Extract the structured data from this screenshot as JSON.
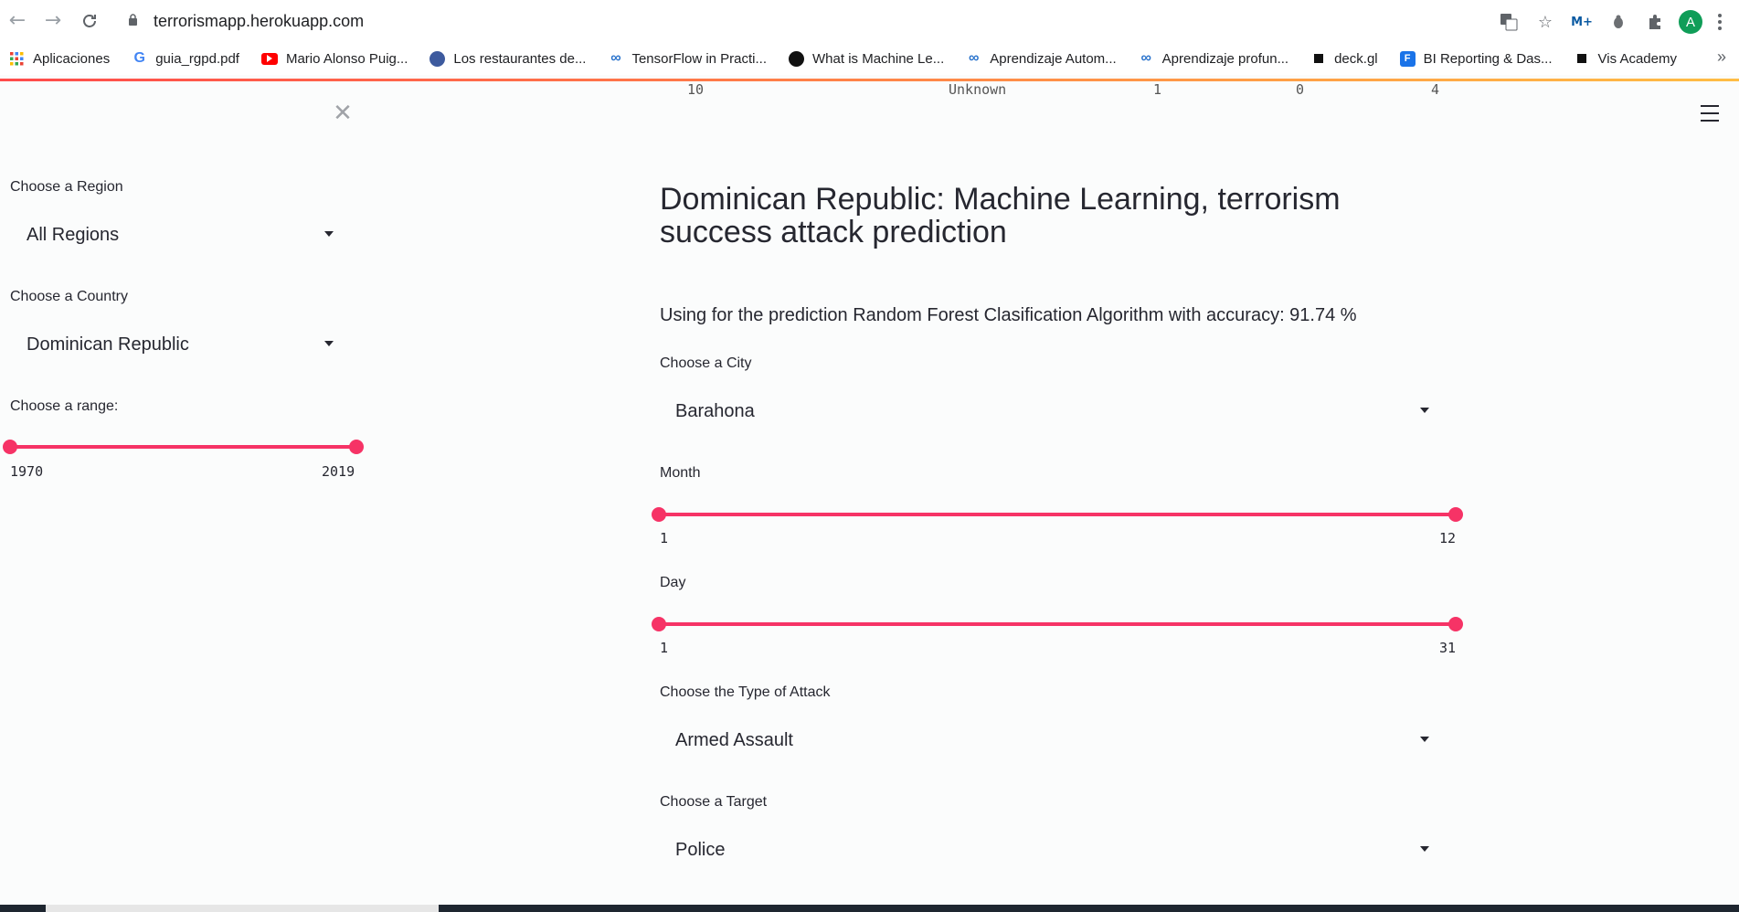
{
  "browser": {
    "url": "terrorismapp.herokuapp.com",
    "profile_initial": "A",
    "bookmarks": [
      {
        "label": "Aplicaciones",
        "icon": "apps-grid-icon"
      },
      {
        "label": "guia_rgpd.pdf",
        "icon": "google-icon"
      },
      {
        "label": "Mario Alonso Puig...",
        "icon": "youtube-icon"
      },
      {
        "label": "Los restaurantes de...",
        "icon": "globe-icon"
      },
      {
        "label": "TensorFlow in Practi...",
        "icon": "coursera-icon"
      },
      {
        "label": "What is Machine Le...",
        "icon": "spiral-icon"
      },
      {
        "label": "Aprendizaje Autom...",
        "icon": "coursera-icon"
      },
      {
        "label": "Aprendizaje profun...",
        "icon": "coursera-icon"
      },
      {
        "label": "deck.gl",
        "icon": "square-icon"
      },
      {
        "label": "BI Reporting & Das...",
        "icon": "bi-icon"
      },
      {
        "label": "Vis Academy",
        "icon": "square-icon"
      }
    ]
  },
  "ghost_row": [
    "10",
    "Unknown",
    "1",
    "0",
    "4"
  ],
  "sidebar": {
    "region_label": "Choose a Region",
    "region_value": "All Regions",
    "country_label": "Choose a Country",
    "country_value": "Dominican Republic",
    "range_label": "Choose a range:",
    "range_min": "1970",
    "range_max": "2019"
  },
  "main": {
    "title": "Dominican Republic: Machine Learning, terrorism success attack prediction",
    "accuracy_text": "Using for the prediction Random Forest Clasification Algorithm with accuracy: 91.74 %",
    "city_label": "Choose a City",
    "city_value": "Barahona",
    "month_label": "Month",
    "month_min": "1",
    "month_max": "12",
    "day_label": "Day",
    "day_min": "1",
    "day_max": "31",
    "attack_label": "Choose the Type of Attack",
    "attack_value": "Armed Assault",
    "target_label": "Choose a Target",
    "target_value": "Police"
  },
  "colors": {
    "accent": "#f63366",
    "text": "#262730",
    "background": "#fbfcfc"
  }
}
